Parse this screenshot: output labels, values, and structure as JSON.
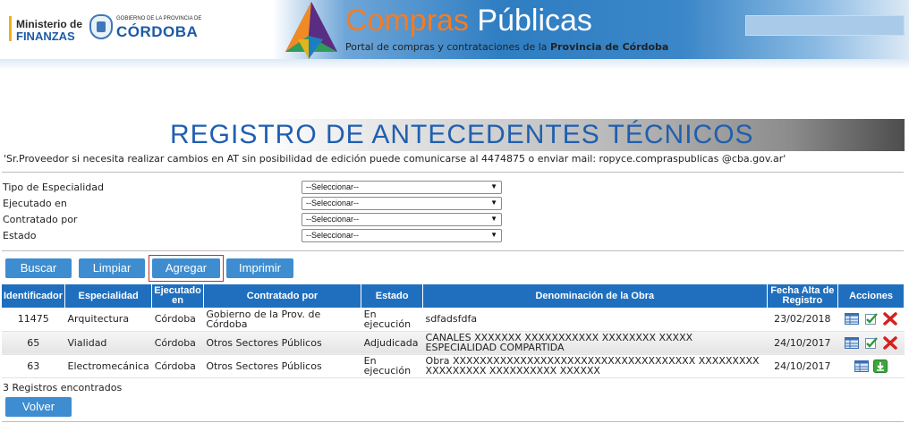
{
  "header": {
    "ministry_line1": "Ministerio de",
    "ministry_line2": "FINANZAS",
    "province_line1": "GOBIERNO DE LA PROVINCIA DE",
    "province_line2": "CÓRDOBA",
    "title_part1": "Compras",
    "title_part2": "Públicas",
    "subtitle_prefix": "Portal de compras y contrataciones de la",
    "subtitle_bold": "Provincia de Córdoba"
  },
  "page": {
    "title": "REGISTRO DE ANTECEDENTES TÉCNICOS",
    "notice": "'Sr.Proveedor si necesita realizar cambios en AT sin posibilidad de edición puede comunicarse al 4474875 o enviar mail: ropyce.compraspublicas @cba.gov.ar'"
  },
  "filters": [
    {
      "label": "Tipo de Especialidad",
      "value": "--Seleccionar--"
    },
    {
      "label": "Ejecutado en",
      "value": "--Seleccionar--"
    },
    {
      "label": "Contratado por",
      "value": "--Seleccionar--"
    },
    {
      "label": "Estado",
      "value": "--Seleccionar--"
    }
  ],
  "buttons": {
    "buscar": "Buscar",
    "limpiar": "Limpiar",
    "agregar": "Agregar",
    "imprimir": "Imprimir",
    "volver": "Volver"
  },
  "table": {
    "headers": [
      "Identificador",
      "Especialidad",
      "Ejecutado en",
      "Contratado por",
      "Estado",
      "Denominación de la Obra",
      "Fecha Alta de Registro",
      "Acciones"
    ],
    "rows": [
      {
        "id": "11475",
        "especialidad": "Arquitectura",
        "ejecutado": "Córdoba",
        "contratado": "Gobierno de la Prov. de Córdoba",
        "estado": "En ejecución",
        "obra": "sdfadsfdfa",
        "fecha": "23/02/2018"
      },
      {
        "id": "65",
        "especialidad": "Vialidad",
        "ejecutado": "Córdoba",
        "contratado": "Otros Sectores Públicos",
        "estado": "Adjudicada",
        "obra": "CANALES XXXXXXX XXXXXXXXXXX XXXXXXXX XXXXX ESPECIALIDAD COMPARTIDA",
        "fecha": "24/10/2017"
      },
      {
        "id": "63",
        "especialidad": "Electromecánica",
        "ejecutado": "Córdoba",
        "contratado": "Otros Sectores Públicos",
        "estado": "En ejecución",
        "obra": "Obra XXXXXXXXXXXXXXXXXXXXXXXXXXXXXXXXXXXX XXXXXXXXX XXXXXXXXX XXXXXXXXXX XXXXXX",
        "fecha": "24/10/2017"
      }
    ]
  },
  "result_count": "3 Registros encontrados",
  "colors": {
    "accent_blue": "#3e8dd0",
    "header_blue": "#1f6fbe",
    "title_blue": "#1f5fb0",
    "brand_orange": "#f57c22",
    "delete_red": "#d62020",
    "download_green": "#3aa83a"
  },
  "icons": {
    "view": "table-view-icon",
    "edit": "edit-check-icon",
    "delete": "delete-x-icon",
    "download": "download-arrow-icon"
  }
}
